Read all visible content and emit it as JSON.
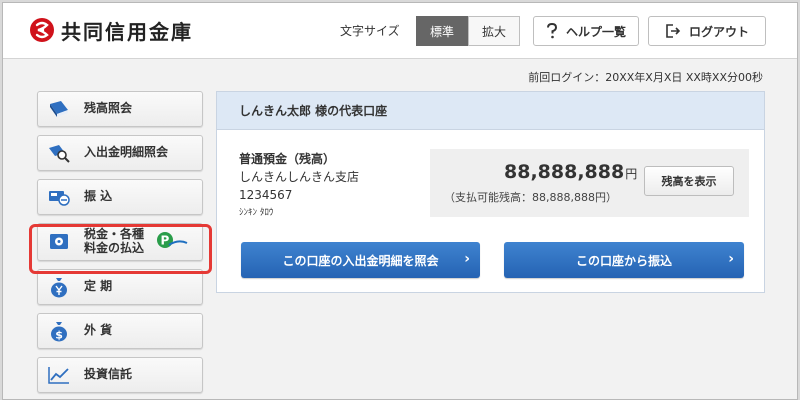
{
  "header": {
    "logo_text": "共同信用金庫",
    "font_size_label": "文字サイズ",
    "font_size_options": [
      "標準",
      "拡大"
    ],
    "font_size_selected": "標準",
    "help_label": "ヘルプ一覧",
    "logout_label": "ログアウト"
  },
  "last_login": "前回ログイン：20XX年X月X日 XX時XX分00秒",
  "sidebar": {
    "items": [
      {
        "label": "残高照会",
        "icon": "book-icon"
      },
      {
        "label": "入出金明細照会",
        "icon": "magnifier-icon"
      },
      {
        "label": "振 込",
        "icon": "transfer-icon"
      },
      {
        "label_line1": "税金・各種",
        "label_line2": "料金の払込",
        "icon": "safe-icon",
        "badge": "pay-easy-logo",
        "highlighted": true
      },
      {
        "label": "定 期",
        "icon": "yen-bag-icon"
      },
      {
        "label": "外 貨",
        "icon": "dollar-bag-icon"
      },
      {
        "label": "投資信託",
        "icon": "chart-icon"
      }
    ]
  },
  "account": {
    "title": "しんきん太郎 様の代表口座",
    "type": "普通預金（残高）",
    "branch": "しんきんしんきん支店",
    "number": "1234567",
    "name_kana": "ｼﾝｷﾝ ﾀﾛｳ",
    "balance": "88,888,888",
    "currency": "円",
    "available": "（支払可能残高：88,888,888円）",
    "show_balance_label": "残高を表示",
    "history_button": "この口座の入出金明細を照会",
    "transfer_button": "この口座から振込"
  },
  "colors": {
    "accent_blue": "#2f6fc0",
    "highlight_red": "#e53935",
    "logo_red": "#d0121b",
    "panel_head_bg": "#dde8f5"
  }
}
